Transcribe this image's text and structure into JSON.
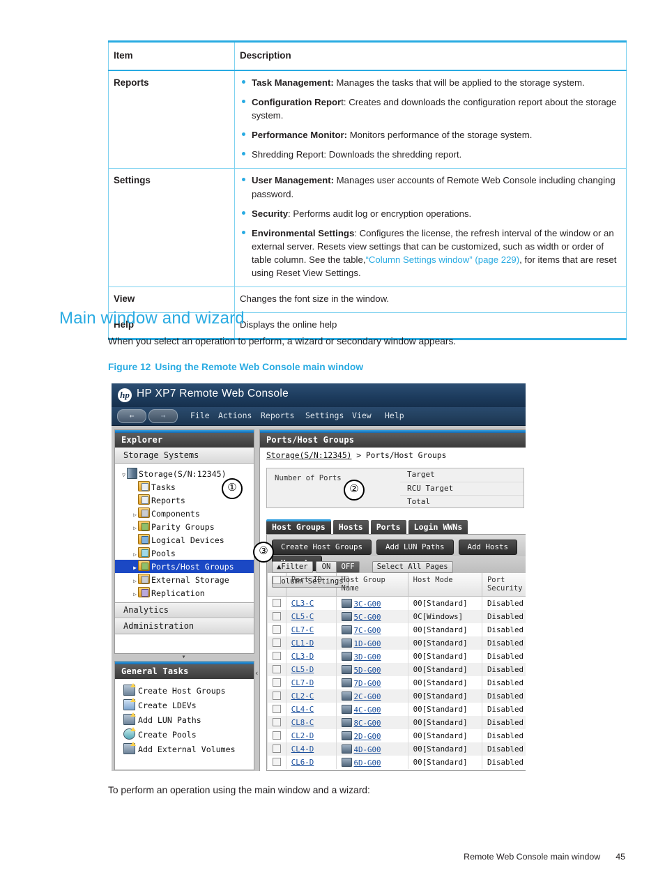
{
  "doc_table": {
    "headers": [
      "Item",
      "Description"
    ],
    "rows": [
      {
        "item": "Reports",
        "bullets": [
          {
            "bold": "Task Management:",
            "rest": " Manages the tasks that will be applied to the storage system."
          },
          {
            "bold": "Configuration Repor",
            "rest": "t: Creates and downloads the configuration report about the storage system."
          },
          {
            "bold": "Performance Monitor:",
            "rest": " Monitors performance of the storage system."
          },
          {
            "bold": "",
            "rest": "Shredding Report: Downloads the shredding report."
          }
        ]
      },
      {
        "item": "Settings",
        "bullets": [
          {
            "bold": "User Management:",
            "rest": " Manages user accounts of Remote Web Console including changing password."
          },
          {
            "bold": "Security",
            "rest": ": Performs audit log or encryption operations."
          },
          {
            "bold": "Environmental Settings",
            "rest": ": Configures the license, the refresh interval of the window or an external server. Resets view settings that can be customized, such as width or order of table column. See the table,",
            "link": "“Column Settings window” (page 229)",
            "after_link": ", for items that are reset using Reset View Settings."
          }
        ]
      },
      {
        "item": "View",
        "text": "Changes the font size in the window."
      },
      {
        "item": "Help",
        "text": "Displays the online help"
      }
    ]
  },
  "section": {
    "heading": "Main window and wizard",
    "intro": "When you select an operation to perform, a wizard or secondary window appears.",
    "outro": "To perform an operation using the main window and a wizard:"
  },
  "figure": {
    "number": "Figure 12",
    "title": "Using the Remote Web Console main window"
  },
  "callouts": {
    "one": "①",
    "two": "②",
    "three": "③"
  },
  "screenshot": {
    "title": "HP XP7 Remote Web Console",
    "logo": "hp-logo",
    "nav": {
      "back": "←",
      "forward": "→"
    },
    "menu": [
      "File",
      "Actions",
      "Reports",
      "Settings",
      "View",
      "Help"
    ],
    "explorer": {
      "header": "Explorer",
      "sections": [
        "Storage Systems",
        "Analytics",
        "Administration"
      ],
      "tree": [
        {
          "label": "Storage(S/N:12345)",
          "twist": "▽",
          "indent": 0,
          "icon": "storage-icon",
          "selected": false
        },
        {
          "label": "Tasks",
          "twist": "",
          "indent": 1,
          "icon": "folder-tasks-icon",
          "selected": false
        },
        {
          "label": "Reports",
          "twist": "",
          "indent": 1,
          "icon": "folder-reports-icon",
          "selected": false
        },
        {
          "label": "Components",
          "twist": "▷",
          "indent": 1,
          "icon": "folder-components-icon",
          "selected": false
        },
        {
          "label": "Parity Groups",
          "twist": "▷",
          "indent": 1,
          "icon": "folder-parity-icon",
          "selected": false
        },
        {
          "label": "Logical Devices",
          "twist": "",
          "indent": 1,
          "icon": "folder-ldev-icon",
          "selected": false
        },
        {
          "label": "Pools",
          "twist": "▷",
          "indent": 1,
          "icon": "folder-pools-icon",
          "selected": false
        },
        {
          "label": "Ports/Host Groups",
          "twist": "▶",
          "indent": 1,
          "icon": "folder-ports-icon",
          "selected": true
        },
        {
          "label": "External Storage",
          "twist": "▷",
          "indent": 1,
          "icon": "folder-external-icon",
          "selected": false
        },
        {
          "label": "Replication",
          "twist": "▷",
          "indent": 1,
          "icon": "folder-replication-icon",
          "selected": false
        }
      ]
    },
    "general_tasks": {
      "header": "General Tasks",
      "items": [
        {
          "label": "Create Host Groups",
          "icon": "create-host-groups-icon"
        },
        {
          "label": "Create LDEVs",
          "icon": "create-ldevs-icon"
        },
        {
          "label": "Add LUN Paths",
          "icon": "add-lun-paths-icon"
        },
        {
          "label": "Create Pools",
          "icon": "create-pools-icon"
        },
        {
          "label": "Add External Volumes",
          "icon": "add-external-volumes-icon"
        }
      ]
    },
    "main": {
      "header": "Ports/Host Groups",
      "breadcrumb_root": "Storage(S/N:12345)",
      "breadcrumb_sep": " > ",
      "breadcrumb_leaf": "Ports/Host Groups",
      "summary_title": "Number of Ports",
      "summary_rows": [
        "Target",
        "RCU Target",
        "Total"
      ],
      "tabs": [
        {
          "label": "Host Groups",
          "active": true
        },
        {
          "label": "Hosts",
          "active": false
        },
        {
          "label": "Ports",
          "active": false
        },
        {
          "label": "Login WWNs",
          "active": false
        }
      ],
      "buttons": [
        "Create Host Groups",
        "Add LUN Paths",
        "Add Hosts",
        "More Ac"
      ],
      "filter": {
        "label": "Filter",
        "filter_icon": "filter-icon",
        "on": "ON",
        "off": "OFF",
        "select_all": "Select All Pages",
        "column_settings": "Column Settings"
      },
      "table": {
        "columns": [
          "Port ID",
          "Host Group Name",
          "Host Mode",
          "Port\nSecurity"
        ],
        "rows": [
          {
            "port_id": "CL3-C",
            "host_group": "3C-G00",
            "host_mode": "00[Standard]",
            "port_security": "Disabled"
          },
          {
            "port_id": "CL5-C",
            "host_group": "5C-G00",
            "host_mode": "0C[Windows]",
            "port_security": "Disabled"
          },
          {
            "port_id": "CL7-C",
            "host_group": "7C-G00",
            "host_mode": "00[Standard]",
            "port_security": "Disabled"
          },
          {
            "port_id": "CL1-D",
            "host_group": "1D-G00",
            "host_mode": "00[Standard]",
            "port_security": "Disabled"
          },
          {
            "port_id": "CL3-D",
            "host_group": "3D-G00",
            "host_mode": "00[Standard]",
            "port_security": "Disabled"
          },
          {
            "port_id": "CL5-D",
            "host_group": "5D-G00",
            "host_mode": "00[Standard]",
            "port_security": "Disabled"
          },
          {
            "port_id": "CL7-D",
            "host_group": "7D-G00",
            "host_mode": "00[Standard]",
            "port_security": "Disabled"
          },
          {
            "port_id": "CL2-C",
            "host_group": "2C-G00",
            "host_mode": "00[Standard]",
            "port_security": "Disabled"
          },
          {
            "port_id": "CL4-C",
            "host_group": "4C-G00",
            "host_mode": "00[Standard]",
            "port_security": "Disabled"
          },
          {
            "port_id": "CL8-C",
            "host_group": "8C-G00",
            "host_mode": "00[Standard]",
            "port_security": "Disabled"
          },
          {
            "port_id": "CL2-D",
            "host_group": "2D-G00",
            "host_mode": "00[Standard]",
            "port_security": "Disabled"
          },
          {
            "port_id": "CL4-D",
            "host_group": "4D-G00",
            "host_mode": "00[Standard]",
            "port_security": "Disabled"
          },
          {
            "port_id": "CL6-D",
            "host_group": "6D-G00",
            "host_mode": "00[Standard]",
            "port_security": "Disabled"
          }
        ]
      }
    }
  },
  "footer": {
    "text": "Remote Web Console main window",
    "page": "45"
  },
  "colors": {
    "accent": "#29abe2",
    "link": "#29abe2",
    "selection": "#1b48c4",
    "grid_link": "#1b4f9c"
  }
}
